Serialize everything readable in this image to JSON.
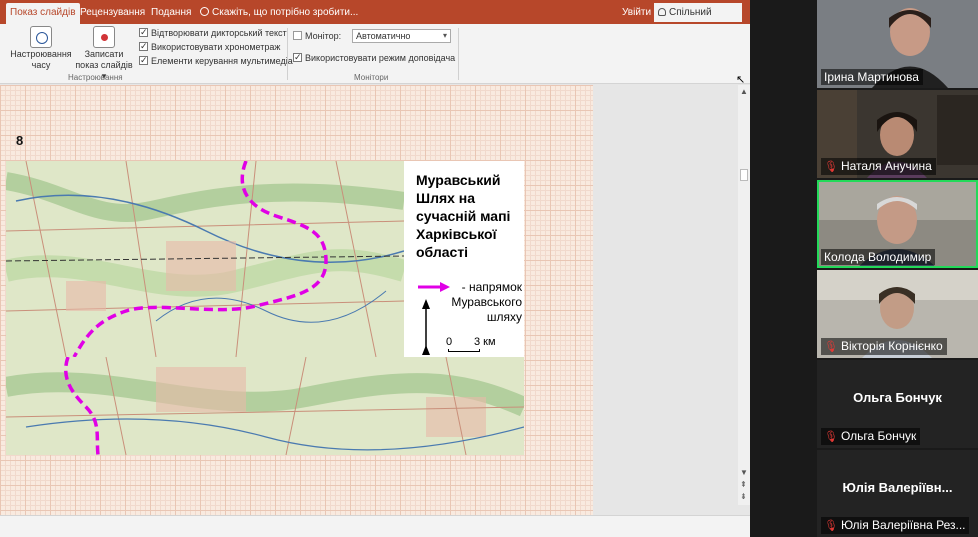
{
  "ribbon": {
    "tabs": [
      {
        "label": "Показ слайдів",
        "active": true
      },
      {
        "label": "Рецензування"
      },
      {
        "label": "Подання"
      }
    ],
    "tell_me": "Скажіть, що потрібно зробити...",
    "sign_in": "Увійти",
    "share": "Спільний доступ",
    "buttons": {
      "rehearse": "Настроювання часу",
      "record": "Записати показ слайдів ▾"
    },
    "checkboxes": [
      "Відтворювати дикторський текст",
      "Використовувати хронометраж",
      "Елементи керування мультимедіа"
    ],
    "setup_group": "Настроювання",
    "monitor_label": "Монітор:",
    "monitor_value": "Автоматично",
    "presenter_view": "Використовувати режим доповідача",
    "monitors_group": "Монітори"
  },
  "slide": {
    "number": "8",
    "map_title": "Муравський Шлях на сучасній мапі Харківської області",
    "legend": "- напрямок Муравського шляху",
    "scale_zero": "0",
    "scale_three": "3 км",
    "route_color": "#e000e6"
  },
  "participants": [
    {
      "name": "Ірина Мартинова",
      "video": true,
      "muted": false
    },
    {
      "name": "Наталя Анучина",
      "video": true,
      "muted": true
    },
    {
      "name": "Колода Володимир",
      "video": true,
      "muted": false,
      "speaking": true
    },
    {
      "name": "Вікторія Корнієнко",
      "video": true,
      "muted": true
    },
    {
      "name": "Ольга Бончук",
      "display": "Ольга Бончук",
      "video": false,
      "muted": true
    },
    {
      "name": "Юлія Валеріївна Рез...",
      "display": "Юлія Валеріївн...",
      "video": false,
      "muted": true
    }
  ]
}
